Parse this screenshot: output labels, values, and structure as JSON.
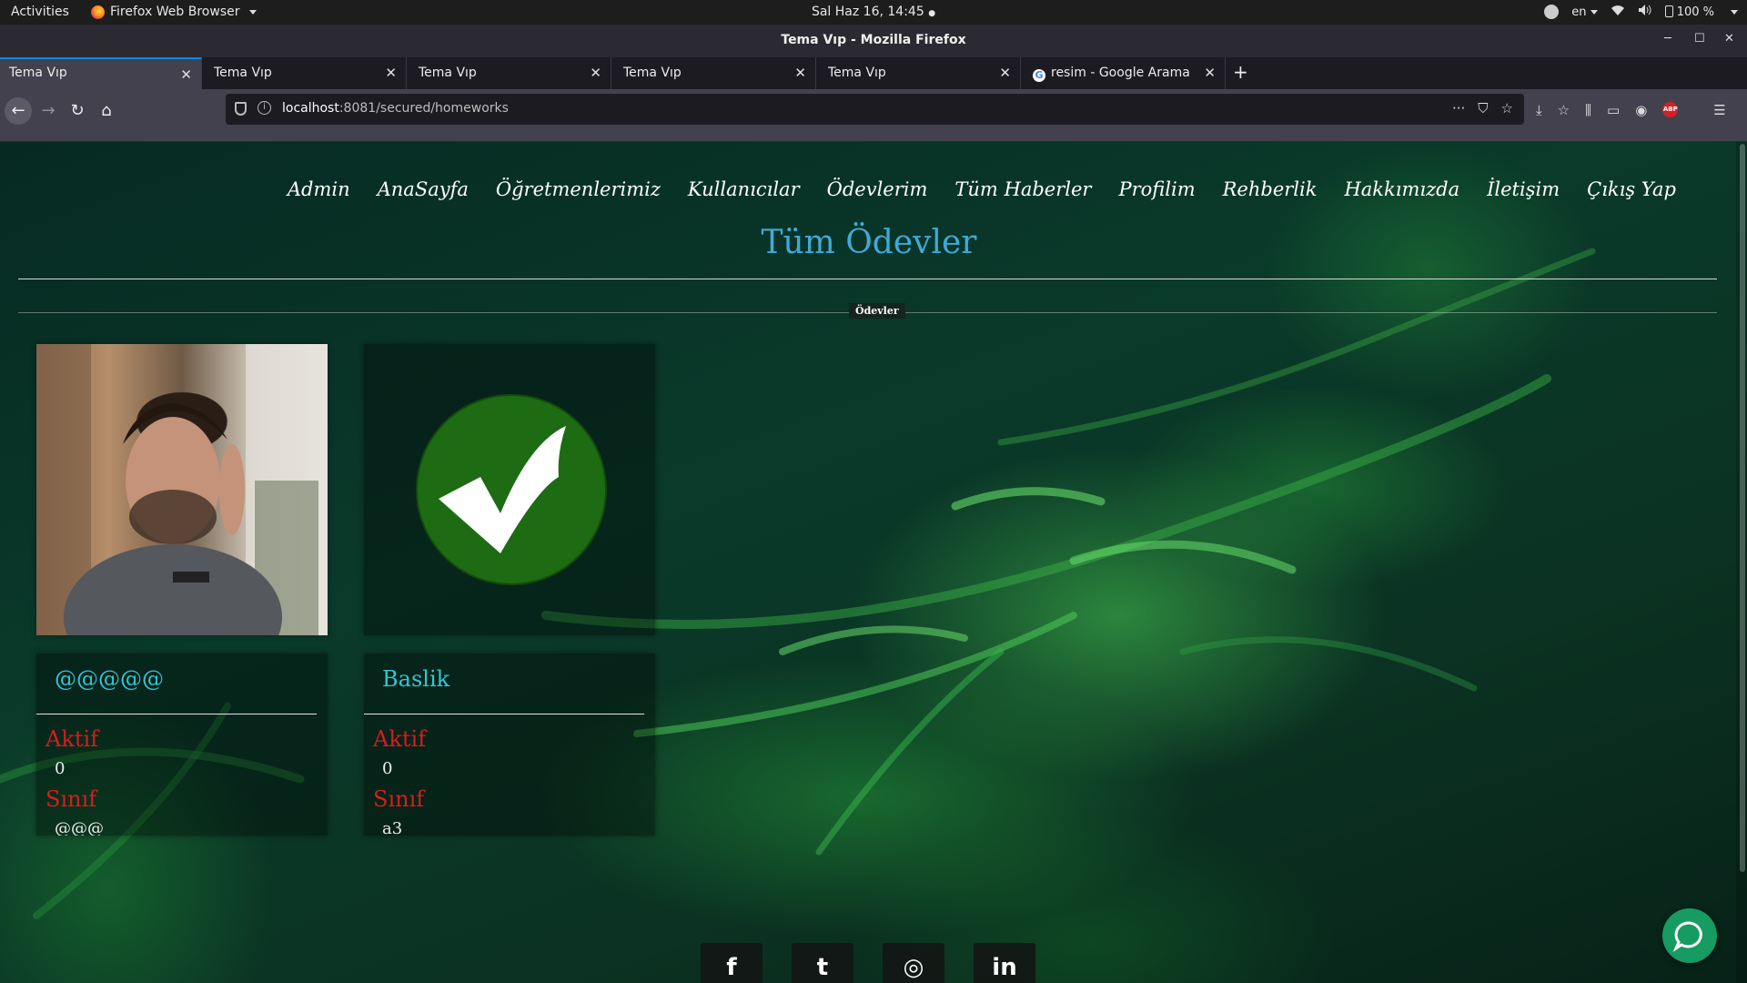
{
  "system_bar": {
    "activities": "Activities",
    "app_menu": "Firefox Web Browser",
    "clock": "Sal Haz 16, 14:45",
    "keyboard_layout": "en",
    "battery": "100 %"
  },
  "window": {
    "title": "Tema Vıp - Mozilla Firefox"
  },
  "tabs": [
    {
      "title": "Tema Vıp",
      "active": true
    },
    {
      "title": "Tema Vıp"
    },
    {
      "title": "Tema Vıp"
    },
    {
      "title": "Tema Vıp"
    },
    {
      "title": "Tema Vıp"
    },
    {
      "title": "resim - Google Arama",
      "favicon": "G"
    }
  ],
  "address_bar": {
    "host": "localhost",
    "path": ":8081/secured/homeworks"
  },
  "nav": {
    "items": [
      "Admin",
      "AnaSayfa",
      "Öğretmenlerimiz",
      "Kullanıcılar",
      "Ödevlerim",
      "Tüm Haberler",
      "Profilim",
      "Rehberlik",
      "Hakkımızda",
      "İletişim",
      "Çıkış Yap"
    ]
  },
  "page": {
    "title": "Tüm Ödevler",
    "section_label": "Ödevler"
  },
  "cards": [
    {
      "image": "user-photo",
      "name": "@@@@@",
      "active_label": "Aktif",
      "active_value": "0",
      "class_label": "Sınıf",
      "class_value": "@@@"
    },
    {
      "image": "checkmark",
      "name": "Baslik",
      "active_label": "Aktif",
      "active_value": "0",
      "class_label": "Sınıf",
      "class_value": "a3"
    }
  ],
  "social": {
    "icons": [
      "facebook-icon",
      "twitter-icon",
      "instagram-icon",
      "linkedin-icon"
    ],
    "glyphs": [
      "f",
      "t",
      "◎",
      "in"
    ]
  },
  "colors": {
    "title": "#41a9d8",
    "card_name": "#34c6d6",
    "card_label": "#d51e1e",
    "check_green": "#1d6b12",
    "chat_button": "#169b62"
  }
}
